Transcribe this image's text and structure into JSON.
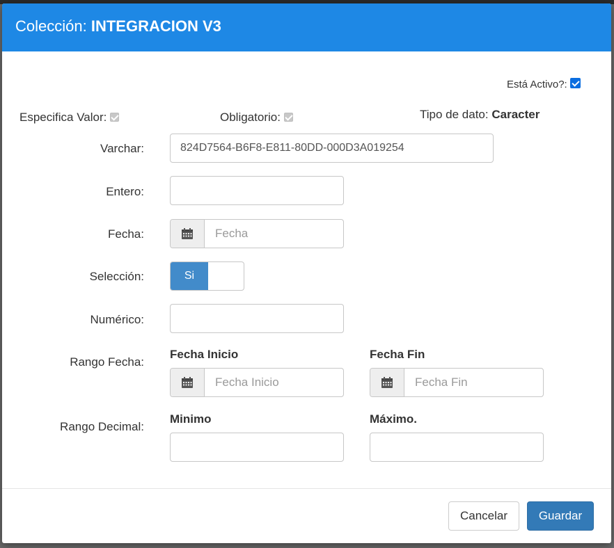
{
  "header": {
    "prefix": "Colección:",
    "collection_name": "INTEGRACION V3"
  },
  "flags": {
    "active_label": "Está Activo?:",
    "active_checked": true,
    "specifies_value_label": "Especifica Valor:",
    "mandatory_label": "Obligatorio:",
    "data_type_label": "Tipo de dato:",
    "data_type_value": "Caracter"
  },
  "fields": {
    "varchar": {
      "label": "Varchar:",
      "value": "824D7564-B6F8-E811-80DD-000D3A019254"
    },
    "entero": {
      "label": "Entero:",
      "value": ""
    },
    "fecha": {
      "label": "Fecha:",
      "placeholder": "Fecha"
    },
    "seleccion": {
      "label": "Selección:",
      "on_label": "Si"
    },
    "numerico": {
      "label": "Numérico:",
      "value": ""
    },
    "rango_fecha": {
      "label": "Rango Fecha:",
      "start_label": "Fecha Inicio",
      "start_placeholder": "Fecha Inicio",
      "end_label": "Fecha Fin",
      "end_placeholder": "Fecha Fin"
    },
    "rango_decimal": {
      "label": "Rango Decimal:",
      "min_label": "Minimo",
      "max_label": "Máximo."
    }
  },
  "footer": {
    "cancel_label": "Cancelar",
    "save_label": "Guardar"
  },
  "icons": {
    "calendar": "calendar-icon"
  },
  "colors": {
    "header_bg": "#1e88e5",
    "primary": "#337ab7",
    "toggle_on": "#428bca",
    "checkbox_active": "#0b6ee0"
  }
}
